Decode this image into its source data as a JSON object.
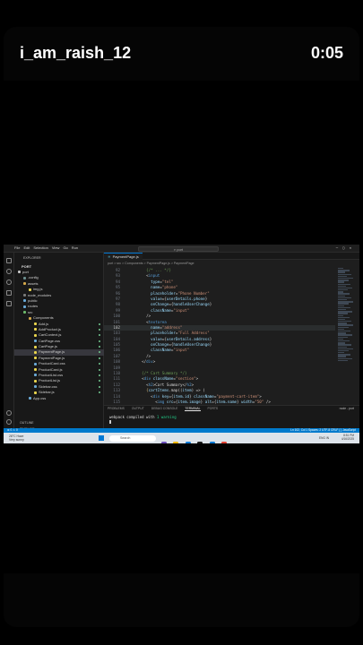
{
  "story": {
    "username": "i_am_raish_12",
    "timer": "0:05"
  },
  "vscode": {
    "menu": [
      "File",
      "Edit",
      "Selection",
      "View",
      "Go",
      "Run"
    ],
    "search": "port",
    "tab": "PaymentPage.js",
    "breadcrumb": "port > src > Components > PaymentPage.js > PaymentPage",
    "explorer": {
      "header": "EXPLORER",
      "project": "PORT",
      "items": [
        {
          "label": "port",
          "color": "#c5c5c5"
        },
        {
          "label": ".config",
          "color": "#6b8e8e"
        },
        {
          "label": "assets",
          "color": "#d6a94a"
        },
        {
          "label": "img.js",
          "color": "#e8d44d"
        },
        {
          "label": "node_modules",
          "color": "#7a7a7a"
        },
        {
          "label": "public",
          "color": "#6aa9d6"
        },
        {
          "label": "routes",
          "color": "#6aa9d6"
        },
        {
          "label": "src",
          "color": "#6bb86b"
        },
        {
          "label": "Components",
          "color": "#d6a94a"
        },
        {
          "label": "Add.js",
          "color": "#e8d44d"
        },
        {
          "label": "AddProduct.js",
          "color": "#e8d44d"
        },
        {
          "label": "CartContext.js",
          "color": "#e8d44d"
        },
        {
          "label": "CartPage.css",
          "color": "#6aa9d6"
        },
        {
          "label": "CartPage.js",
          "color": "#e8d44d"
        },
        {
          "label": "PaymentPage.js",
          "color": "#e8d44d"
        },
        {
          "label": "PaymentPage.js",
          "color": "#e8d44d"
        },
        {
          "label": "ProductCard.css",
          "color": "#6aa9d6"
        },
        {
          "label": "ProductCard.js",
          "color": "#e8d44d"
        },
        {
          "label": "ProductList.css",
          "color": "#6aa9d6"
        },
        {
          "label": "ProductList.js",
          "color": "#e8d44d"
        },
        {
          "label": "Sidebar.css",
          "color": "#6aa9d6"
        },
        {
          "label": "Sidebar.js",
          "color": "#e8d44d"
        },
        {
          "label": "App.css",
          "color": "#6aa9d6"
        }
      ],
      "outline": "OUTLINE",
      "timeline": "TIMELINE"
    },
    "code": [
      {
        "n": "92",
        "tokens": [
          {
            "t": "      {/* ... */}",
            "c": "cmt"
          }
        ]
      },
      {
        "n": "93",
        "tokens": [
          {
            "t": "      <",
            "c": "plain"
          },
          {
            "t": "input",
            "c": "tag"
          }
        ]
      },
      {
        "n": "94",
        "tokens": [
          {
            "t": "        type",
            "c": "attr"
          },
          {
            "t": "=",
            "c": "plain"
          },
          {
            "t": "\"tel\"",
            "c": "str"
          }
        ]
      },
      {
        "n": "95",
        "tokens": [
          {
            "t": "        name",
            "c": "attr"
          },
          {
            "t": "=",
            "c": "plain"
          },
          {
            "t": "\"phone\"",
            "c": "str"
          }
        ]
      },
      {
        "n": "96",
        "tokens": [
          {
            "t": "        placeholder",
            "c": "attr"
          },
          {
            "t": "=",
            "c": "plain"
          },
          {
            "t": "\"Phone Number\"",
            "c": "str"
          }
        ]
      },
      {
        "n": "97",
        "tokens": [
          {
            "t": "        value",
            "c": "attr"
          },
          {
            "t": "={",
            "c": "plain"
          },
          {
            "t": "userDetails.phone",
            "c": "attr"
          },
          {
            "t": "}",
            "c": "plain"
          }
        ]
      },
      {
        "n": "98",
        "tokens": [
          {
            "t": "        onChange",
            "c": "attr"
          },
          {
            "t": "={",
            "c": "plain"
          },
          {
            "t": "handleUserChange",
            "c": "attr"
          },
          {
            "t": "}",
            "c": "plain"
          }
        ]
      },
      {
        "n": "99",
        "tokens": [
          {
            "t": "        className",
            "c": "attr"
          },
          {
            "t": "=",
            "c": "plain"
          },
          {
            "t": "\"input\"",
            "c": "str"
          }
        ]
      },
      {
        "n": "100",
        "tokens": [
          {
            "t": "      />",
            "c": "plain"
          }
        ]
      },
      {
        "n": "101",
        "tokens": [
          {
            "t": "      <",
            "c": "plain"
          },
          {
            "t": "textarea",
            "c": "tag"
          }
        ]
      },
      {
        "n": "102",
        "tokens": [
          {
            "t": "        name",
            "c": "attr"
          },
          {
            "t": "=",
            "c": "plain"
          },
          {
            "t": "\"address\"",
            "c": "str"
          }
        ]
      },
      {
        "n": "103",
        "tokens": [
          {
            "t": "        placeholder",
            "c": "attr"
          },
          {
            "t": "=",
            "c": "plain"
          },
          {
            "t": "\"Full Address\"",
            "c": "str"
          }
        ]
      },
      {
        "n": "104",
        "tokens": [
          {
            "t": "        value",
            "c": "attr"
          },
          {
            "t": "={",
            "c": "plain"
          },
          {
            "t": "userDetails.address",
            "c": "attr"
          },
          {
            "t": "}",
            "c": "plain"
          }
        ]
      },
      {
        "n": "105",
        "tokens": [
          {
            "t": "        onChange",
            "c": "attr"
          },
          {
            "t": "={",
            "c": "plain"
          },
          {
            "t": "handleUserChange",
            "c": "attr"
          },
          {
            "t": "}",
            "c": "plain"
          }
        ]
      },
      {
        "n": "106",
        "tokens": [
          {
            "t": "        className",
            "c": "attr"
          },
          {
            "t": "=",
            "c": "plain"
          },
          {
            "t": "\"input\"",
            "c": "str"
          }
        ]
      },
      {
        "n": "107",
        "tokens": [
          {
            "t": "      />",
            "c": "plain"
          }
        ]
      },
      {
        "n": "108",
        "tokens": [
          {
            "t": "    </",
            "c": "plain"
          },
          {
            "t": "div",
            "c": "tag"
          },
          {
            "t": ">",
            "c": "plain"
          }
        ]
      },
      {
        "n": "109",
        "tokens": [
          {
            "t": "",
            "c": "plain"
          }
        ]
      },
      {
        "n": "110",
        "tokens": [
          {
            "t": "    {/* Cart Summary */}",
            "c": "cmt"
          }
        ]
      },
      {
        "n": "111",
        "tokens": [
          {
            "t": "    <",
            "c": "plain"
          },
          {
            "t": "div",
            "c": "tag"
          },
          {
            "t": " className",
            "c": "attr"
          },
          {
            "t": "=",
            "c": "plain"
          },
          {
            "t": "\"section\"",
            "c": "str"
          },
          {
            "t": ">",
            "c": "plain"
          }
        ]
      },
      {
        "n": "112",
        "tokens": [
          {
            "t": "      <",
            "c": "plain"
          },
          {
            "t": "h2",
            "c": "tag"
          },
          {
            "t": ">",
            "c": "plain"
          },
          {
            "t": "Cart Summary",
            "c": "plain"
          },
          {
            "t": "</",
            "c": "plain"
          },
          {
            "t": "h2",
            "c": "tag"
          },
          {
            "t": ">",
            "c": "plain"
          }
        ]
      },
      {
        "n": "113",
        "tokens": [
          {
            "t": "      {",
            "c": "brk"
          },
          {
            "t": "cartItems",
            "c": "attr"
          },
          {
            "t": ".map((",
            "c": "plain"
          },
          {
            "t": "item",
            "c": "attr"
          },
          {
            "t": ") => (",
            "c": "plain"
          }
        ]
      },
      {
        "n": "114",
        "tokens": [
          {
            "t": "        <",
            "c": "plain"
          },
          {
            "t": "div",
            "c": "tag"
          },
          {
            "t": " key",
            "c": "attr"
          },
          {
            "t": "={",
            "c": "plain"
          },
          {
            "t": "item.id",
            "c": "attr"
          },
          {
            "t": "} ",
            "c": "plain"
          },
          {
            "t": "className",
            "c": "attr"
          },
          {
            "t": "=",
            "c": "plain"
          },
          {
            "t": "\"payment-cart-item\"",
            "c": "str"
          },
          {
            "t": ">",
            "c": "plain"
          }
        ]
      },
      {
        "n": "115",
        "tokens": [
          {
            "t": "          <",
            "c": "plain"
          },
          {
            "t": "img",
            "c": "tag"
          },
          {
            "t": " src",
            "c": "attr"
          },
          {
            "t": "={",
            "c": "plain"
          },
          {
            "t": "item.image",
            "c": "attr"
          },
          {
            "t": "} ",
            "c": "plain"
          },
          {
            "t": "alt",
            "c": "attr"
          },
          {
            "t": "={",
            "c": "plain"
          },
          {
            "t": "item.name",
            "c": "attr"
          },
          {
            "t": "} ",
            "c": "plain"
          },
          {
            "t": "width",
            "c": "attr"
          },
          {
            "t": "=",
            "c": "plain"
          },
          {
            "t": "\"50\"",
            "c": "str"
          },
          {
            "t": " />",
            "c": "plain"
          }
        ]
      }
    ],
    "current_line": "102",
    "panel": {
      "tabs": [
        "PROBLEMS",
        "OUTPUT",
        "DEBUG CONSOLE",
        "TERMINAL",
        "PORTS"
      ],
      "active_tab": "TERMINAL",
      "terminal_name": "node - port",
      "output_prefix": "webpack compiled with ",
      "output_ok": "1 warning"
    },
    "status": {
      "left": "⊗ 0 ⚠ 0",
      "right": "Ln 102, Col 1   Spaces: 2   UTF-8   CRLF   { } JavaScript"
    },
    "taskbar": {
      "weather_temp": "28°C Haze",
      "weather_sub": "Very sunny",
      "search": "Search",
      "lang": "ENG IN",
      "time": "8:51 PM",
      "date": "4/16/2025"
    }
  }
}
